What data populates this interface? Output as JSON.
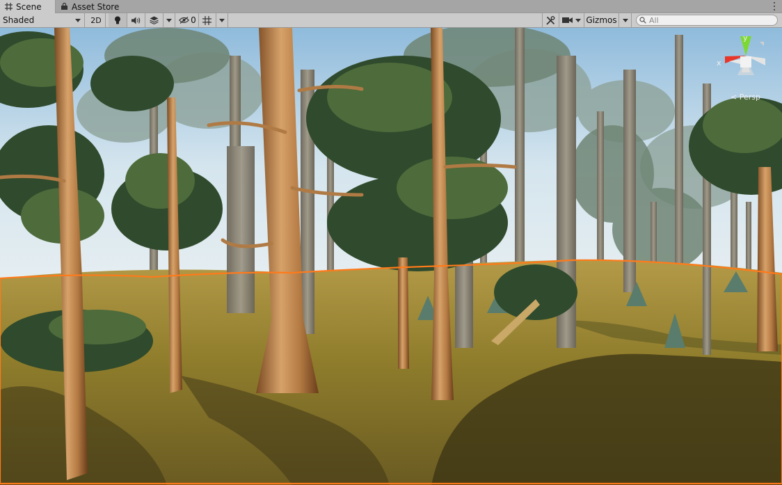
{
  "tabs": [
    {
      "label": "Scene",
      "icon": "grid-icon",
      "active": true
    },
    {
      "label": "Asset Store",
      "icon": "bag-icon",
      "active": false
    }
  ],
  "toolbar": {
    "shading_mode": "Shaded",
    "mode_2d": "2D",
    "hidden_count": "0",
    "gizmos_label": "Gizmos",
    "search_placeholder": "All"
  },
  "gizmo": {
    "y_label": "y",
    "x_label": "x",
    "projection": "< Persp"
  },
  "colors": {
    "selection_outline": "#ff7a1a",
    "gizmo_y": "#7dd834",
    "gizmo_x": "#e8372a",
    "sky": "#dce9f0"
  }
}
